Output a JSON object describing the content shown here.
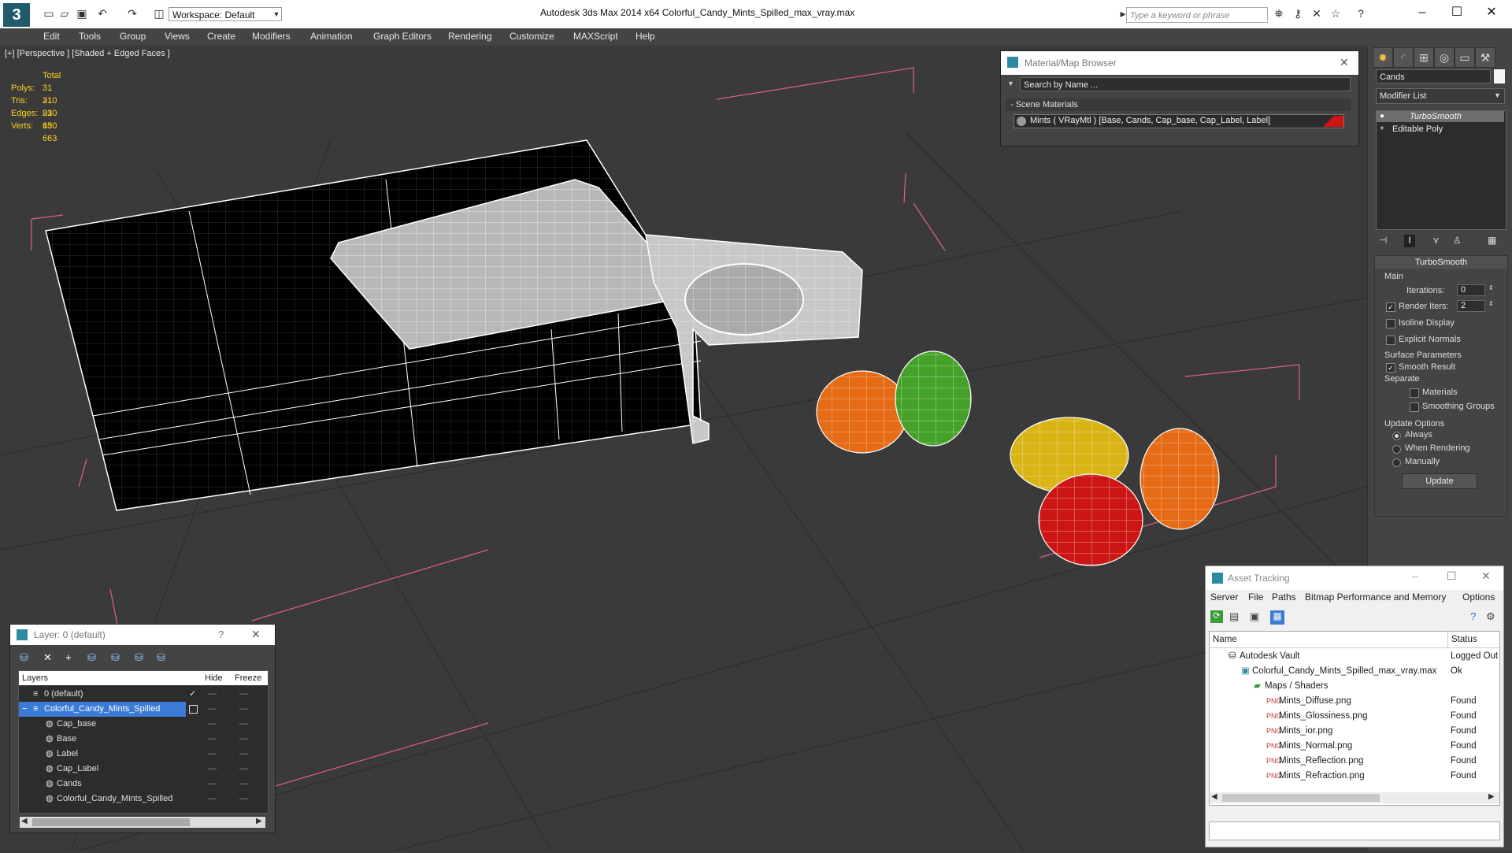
{
  "title_bar": {
    "workspace": "Workspace: Default",
    "title": "Autodesk 3ds Max  2014 x64      Colorful_Candy_Mints_Spilled_max_vray.max",
    "search_placeholder": "Type a keyword or phrase"
  },
  "menu": [
    "Edit",
    "Tools",
    "Group",
    "Views",
    "Create",
    "Modifiers",
    "Animation",
    "Graph Editors",
    "Rendering",
    "Customize",
    "MAXScript",
    "Help"
  ],
  "viewport": {
    "label": "[+] [Perspective ] [Shaded + Edged Faces ]",
    "stats": {
      "header": "Total",
      "rows": [
        {
          "label": "Polys:",
          "value": "31 210"
        },
        {
          "label": "Tris:",
          "value": "31 210"
        },
        {
          "label": "Edges:",
          "value": "93 630"
        },
        {
          "label": "Verts:",
          "value": "15 663"
        }
      ]
    }
  },
  "material_browser": {
    "title": "Material/Map Browser",
    "search_placeholder": "Search by Name ...",
    "section": "- Scene Materials",
    "material": "Mints  ( VRayMtl )  [Base, Cands, Cap_base, Cap_Label, Label]"
  },
  "command_panel": {
    "object_name": "Cands",
    "modifier_list": "Modifier List",
    "stack": [
      "TurboSmooth",
      "Editable Poly"
    ],
    "rollout_title": "TurboSmooth",
    "main": "Main",
    "iterations_label": "Iterations:",
    "iterations_value": "0",
    "render_iters_label": "Render Iters:",
    "render_iters_value": "2",
    "isoline": "Isoline Display",
    "explicit_normals": "Explicit Normals",
    "surface_params": "Surface Parameters",
    "smooth_result": "Smooth Result",
    "separate": "Separate",
    "materials": "Materials",
    "smoothing_groups": "Smoothing Groups",
    "update_options": "Update Options",
    "always": "Always",
    "when_rendering": "When Rendering",
    "manually": "Manually",
    "update_button": "Update"
  },
  "layer_panel": {
    "title": "Layer: 0 (default)",
    "help": "?",
    "columns": {
      "layers": "Layers",
      "hide": "Hide",
      "freeze": "Freeze"
    },
    "rows": [
      {
        "name": "0 (default)",
        "indent": 0
      },
      {
        "name": "Colorful_Candy_Mints_Spilled",
        "indent": 0
      },
      {
        "name": "Cap_base",
        "indent": 1
      },
      {
        "name": "Base",
        "indent": 1
      },
      {
        "name": "Label",
        "indent": 1
      },
      {
        "name": "Cap_Label",
        "indent": 1
      },
      {
        "name": "Cands",
        "indent": 1
      },
      {
        "name": "Colorful_Candy_Mints_Spilled",
        "indent": 1
      }
    ]
  },
  "asset_tracking": {
    "title": "Asset Tracking",
    "menu": [
      "Server",
      "File",
      "Paths",
      "Bitmap Performance and Memory",
      "Options"
    ],
    "columns": {
      "name": "Name",
      "status": "Status"
    },
    "rows": [
      {
        "name": "Autodesk Vault",
        "status": "Logged Out"
      },
      {
        "name": "Colorful_Candy_Mints_Spilled_max_vray.max",
        "status": "Ok"
      },
      {
        "name": "Maps / Shaders",
        "status": ""
      },
      {
        "name": "Mints_Diffuse.png",
        "status": "Found"
      },
      {
        "name": "Mints_Glossiness.png",
        "status": "Found"
      },
      {
        "name": "Mints_ior.png",
        "status": "Found"
      },
      {
        "name": "Mints_Normal.png",
        "status": "Found"
      },
      {
        "name": "Mints_Reflection.png",
        "status": "Found"
      },
      {
        "name": "Mints_Refraction.png",
        "status": "Found"
      }
    ]
  },
  "colors": {
    "selection": "#3b7bd6",
    "stats": "#ffd21f",
    "candy_orange": "#e56b16",
    "candy_green": "#46a12a",
    "candy_yellow": "#d8b414",
    "candy_red": "#cc1515"
  }
}
